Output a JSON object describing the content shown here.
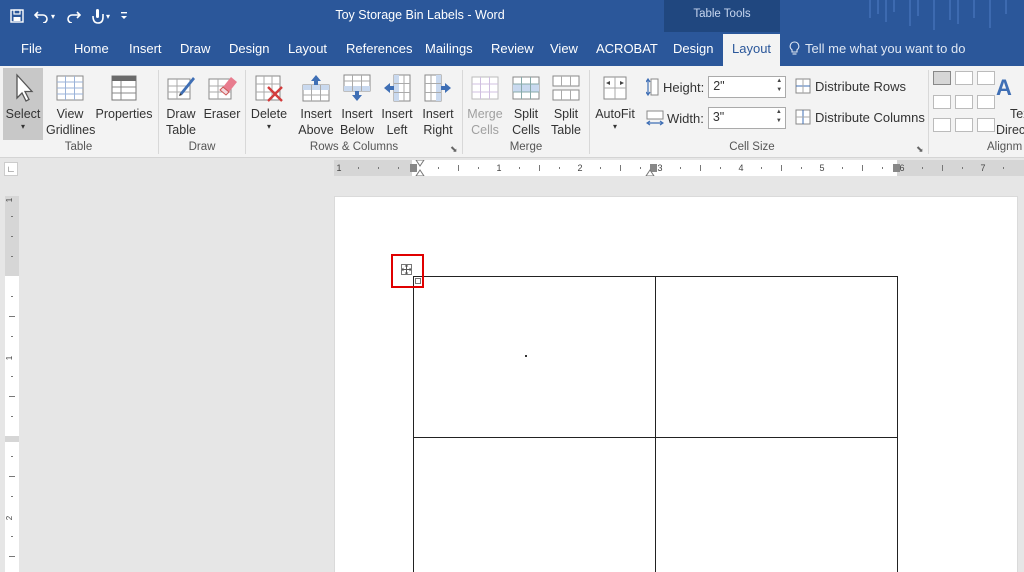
{
  "title_bar": {
    "document_title": "Toy Storage Bin Labels - Word",
    "contextual_group": "Table Tools",
    "quick_access": [
      {
        "name": "save-icon"
      },
      {
        "name": "undo-icon"
      },
      {
        "name": "redo-icon"
      },
      {
        "name": "touch-mode-icon"
      },
      {
        "name": "customize-qat-icon"
      }
    ]
  },
  "tabs": {
    "file": "File",
    "home": "Home",
    "insert": "Insert",
    "draw": "Draw",
    "design": "Design",
    "layout": "Layout",
    "references": "References",
    "mailings": "Mailings",
    "review": "Review",
    "view": "View",
    "acrobat": "ACROBAT",
    "table_design": "Design",
    "table_layout": "Layout",
    "active": "table_layout"
  },
  "tell_me": "Tell me what you want to do",
  "ribbon": {
    "table": {
      "group": "Table",
      "select_l1": "Select",
      "view_l1": "View",
      "view_l2": "Gridlines",
      "properties": "Properties"
    },
    "draw": {
      "group": "Draw",
      "draw_l1": "Draw",
      "draw_l2": "Table",
      "eraser": "Eraser"
    },
    "rows_columns": {
      "group": "Rows & Columns",
      "delete": "Delete",
      "above_l1": "Insert",
      "above_l2": "Above",
      "below_l1": "Insert",
      "below_l2": "Below",
      "left_l1": "Insert",
      "left_l2": "Left",
      "right_l1": "Insert",
      "right_l2": "Right"
    },
    "merge": {
      "group": "Merge",
      "merge_l1": "Merge",
      "merge_l2": "Cells",
      "split_cells_l1": "Split",
      "split_cells_l2": "Cells",
      "split_table_l1": "Split",
      "split_table_l2": "Table"
    },
    "cell_size": {
      "group": "Cell Size",
      "autofit": "AutoFit",
      "height_label": "Height:",
      "height_value": "2\"",
      "width_label": "Width:",
      "width_value": "3\"",
      "distribute_rows": "Distribute Rows",
      "distribute_columns": "Distribute Columns"
    },
    "alignment": {
      "group": "Alignm",
      "text_direction_l1": "Tex",
      "text_direction_l2": "Direc"
    }
  },
  "ruler": {
    "h_numbers": [
      "1",
      "1",
      "2",
      "3",
      "4",
      "5",
      "6",
      "7"
    ],
    "v_numbers": [
      "1",
      "1",
      "2"
    ]
  },
  "colors": {
    "title_bar": "#2b579a",
    "contextual_band": "#20477f",
    "ribbon": "#f3f3f3",
    "highlight": "#e00000"
  }
}
